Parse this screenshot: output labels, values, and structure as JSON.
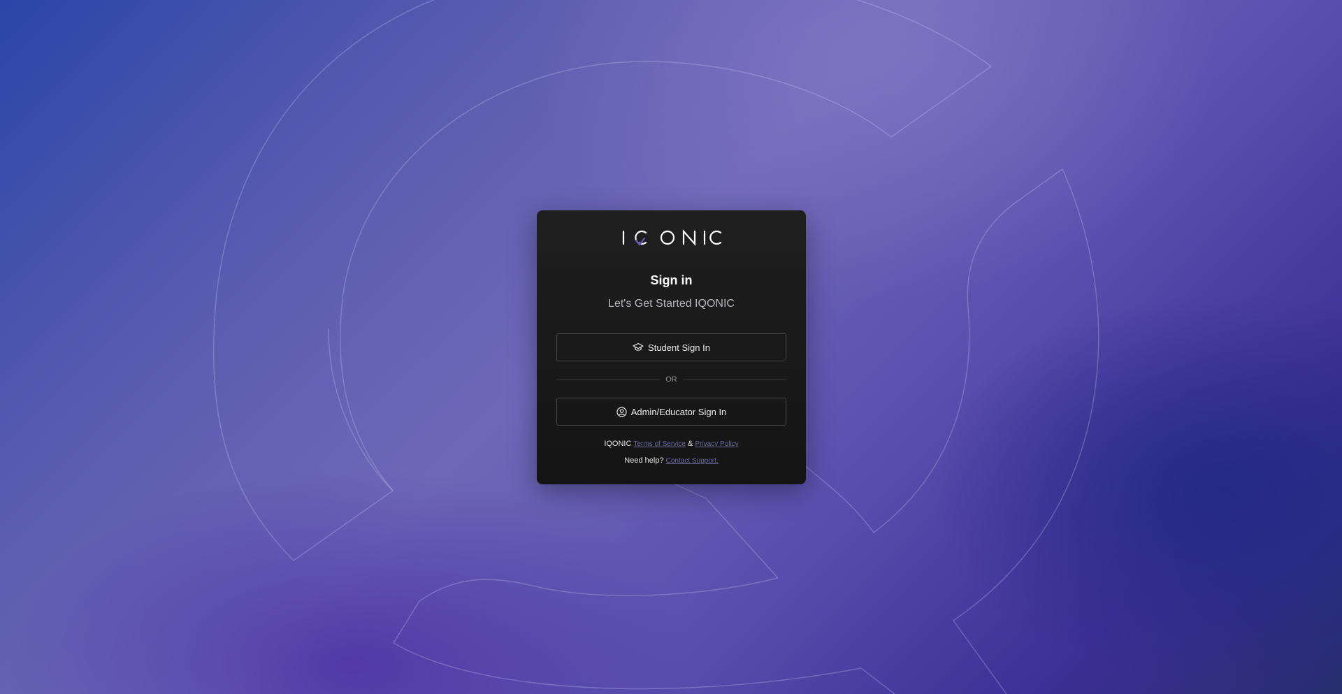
{
  "brand": {
    "name": "IQONIC",
    "colors": {
      "card_background": "#1a1a1a",
      "accent": "#6d6a9e",
      "logo_q_tail": "#6a55c6"
    }
  },
  "auth": {
    "title": "Sign in",
    "subtitle": "Let's Get Started IQONIC",
    "student_button": {
      "label": "Student Sign In",
      "icon": "graduation-cap-icon"
    },
    "divider_label": "OR",
    "admin_button": {
      "label": "Admin/Educator Sign In",
      "icon": "user-circle-icon"
    }
  },
  "footer": {
    "brand_prefix": "IQONIC",
    "terms_label": "Terms of Service",
    "ampersand": "&",
    "privacy_label": "Privacy Policy",
    "help_prefix": "Need help?",
    "support_label": "Contact Support."
  }
}
